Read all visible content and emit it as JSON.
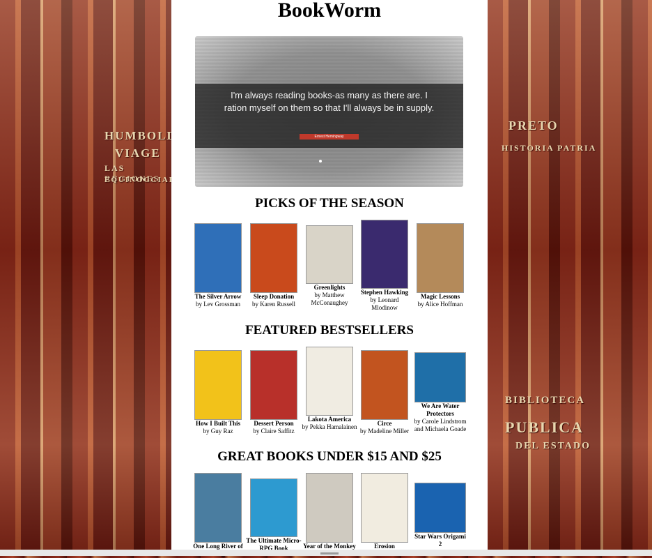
{
  "site": {
    "title": "BookWorm"
  },
  "hero": {
    "quote": "I'm always reading books-as many as there are. I ration myself on them so that I'll always be in supply.",
    "author": "Ernest Hemingway"
  },
  "sections": [
    {
      "title": "PICKS OF THE SEASON",
      "books": [
        {
          "title": "The Silver Arrow",
          "author": "by Lev Grossman",
          "cover_color": "#2f6fb8"
        },
        {
          "title": "Sleep Donation",
          "author": "by Karen Russell",
          "cover_color": "#c94a1c"
        },
        {
          "title": "Greenlights",
          "author": "by Matthew McConaughey",
          "cover_color": "#d9d4c8"
        },
        {
          "title": "Stephen Hawking",
          "author": "by Leonard Mlodinow",
          "cover_color": "#3a2a6e"
        },
        {
          "title": "Magic Lessons",
          "author": "by Alice Hoffman",
          "cover_color": "#b48a5a"
        }
      ]
    },
    {
      "title": "FEATURED BESTSELLERS",
      "books": [
        {
          "title": "How I Built This",
          "author": "by Guy Raz",
          "cover_color": "#f2c21a"
        },
        {
          "title": "Dessert Person",
          "author": "by Claire Saffitz",
          "cover_color": "#b8302a"
        },
        {
          "title": "Lakota America",
          "author": "by Pekka Hamalainen",
          "cover_color": "#f0ece2"
        },
        {
          "title": "Circe",
          "author": "by Madeline Miller",
          "cover_color": "#c2541f"
        },
        {
          "title": "We Are Water Protectors",
          "author": "by Carole Lindstrom and Michaela Goade",
          "cover_color": "#1f6fa8"
        }
      ]
    },
    {
      "title": "GREAT BOOKS UNDER $15 AND $25",
      "books": [
        {
          "title": "One Long River of Song",
          "author": "",
          "cover_color": "#4a7da0"
        },
        {
          "title": "The Ultimate Micro-RPG Book",
          "author": "",
          "cover_color": "#2d9ad0"
        },
        {
          "title": "Year of the Monkey",
          "author": "",
          "cover_color": "#cfcac0"
        },
        {
          "title": "Erosion",
          "author": "",
          "cover_color": "#f1ece0"
        },
        {
          "title": "Star Wars Origami 2",
          "author": "",
          "cover_color": "#1a63b0"
        }
      ]
    }
  ],
  "backdrop": {
    "left_spines": [
      "HUMBOLDT",
      "VIAGE",
      "LAS REGIONES",
      "EQUINOCCIAL"
    ],
    "right_spines": [
      "PRETO",
      "HISTORIA PATRIA",
      "BIBLIOTECA",
      "PUBLICA",
      "DEL ESTADO"
    ]
  }
}
